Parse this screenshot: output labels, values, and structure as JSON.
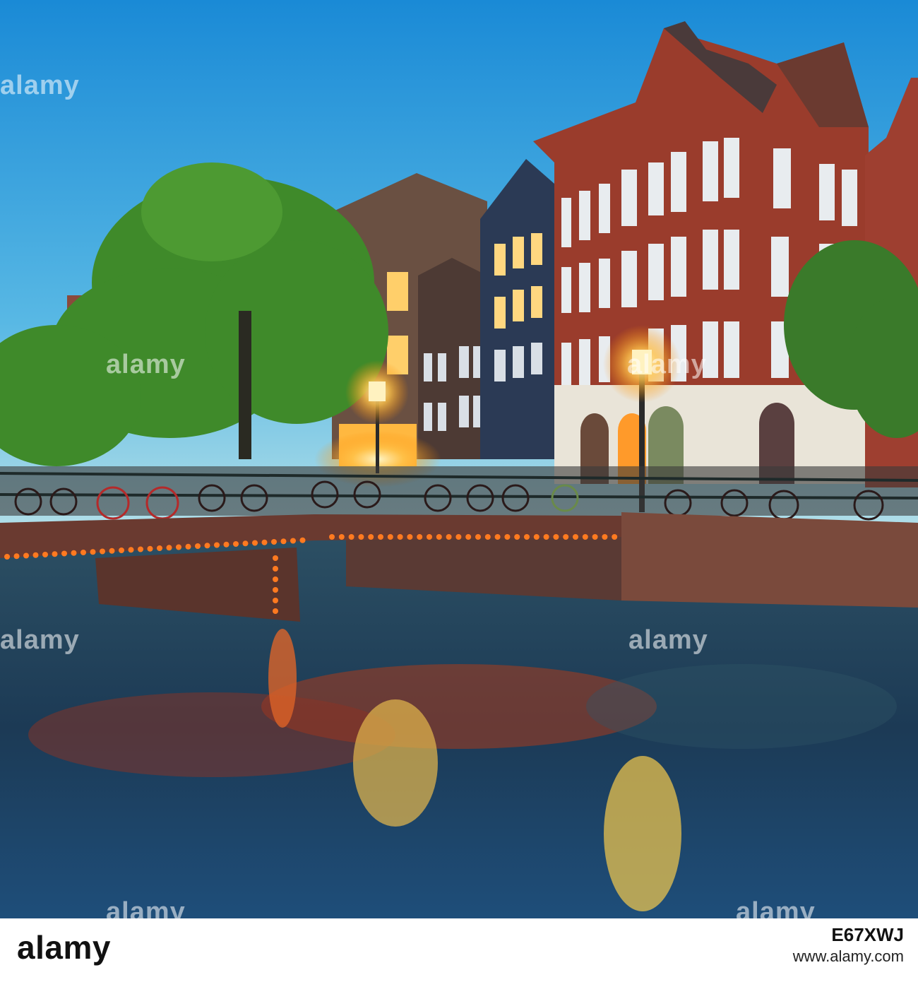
{
  "photo": {
    "subject": "Amsterdam canal at dusk",
    "watermark_text": "alamy",
    "colors": {
      "sky_top": "#1f8fd8",
      "sky_bottom": "#a9dbe6",
      "brick": "#9a3b2c",
      "tree": "#3f8a2a",
      "water": "#1c3f5a",
      "bridge_lights": "#ff6a1a",
      "lamp_glow": "#ffd36a"
    }
  },
  "footer": {
    "logo": "alamy",
    "image_code": "E67XWJ",
    "site": "www.alamy.com"
  }
}
